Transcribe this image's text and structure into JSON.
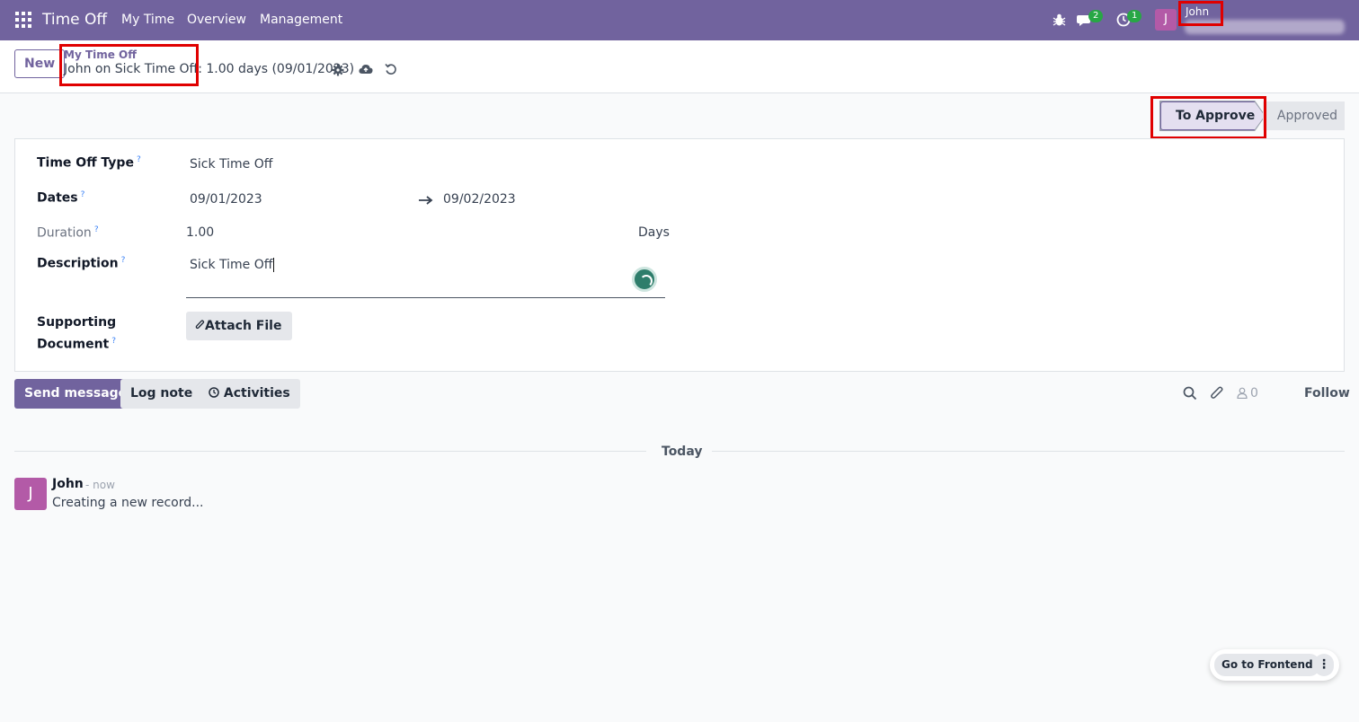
{
  "navbar": {
    "app_title": "Time Off",
    "menu": [
      "My Time",
      "Overview",
      "Management"
    ],
    "messages_count": "2",
    "activities_count": "1",
    "avatar_letter": "J",
    "user_name": "John"
  },
  "control_panel": {
    "new_label": "New",
    "breadcrumb_parent": "My Time Off",
    "breadcrumb_current": "John on Sick Time Off: 1.00 days (09/01/2023)"
  },
  "statusbar": {
    "stages": [
      "To Approve",
      "Approved"
    ],
    "active_stage": "To Approve"
  },
  "form": {
    "time_off_type_label": "Time Off Type",
    "time_off_type_value": "Sick Time Off",
    "dates_label": "Dates",
    "date_from": "09/01/2023",
    "date_to": "09/02/2023",
    "duration_label": "Duration",
    "duration_value": "1.00",
    "duration_unit": "Days",
    "description_label": "Description",
    "description_value": "Sick Time Off",
    "supporting_label_1": "Supporting",
    "supporting_label_2": "Document",
    "attach_label": "Attach File",
    "help_mark": "?"
  },
  "chatter": {
    "send_message": "Send message",
    "log_note": "Log note",
    "activities": "Activities",
    "followers_count": "0",
    "follow": "Follow",
    "date_separator": "Today",
    "message": {
      "avatar_letter": "J",
      "author": "John",
      "time": "- now",
      "body": "Creating a new record..."
    }
  },
  "floating": {
    "go_to_frontend": "Go to Frontend"
  },
  "colors": {
    "brand": "#71639e",
    "highlight": "#e00000",
    "avatar": "#b35aa7",
    "badge": "#28a745"
  }
}
